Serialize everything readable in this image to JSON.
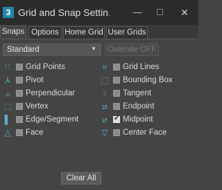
{
  "window": {
    "app_icon_text": "3",
    "title": "Grid and Snap Settin...",
    "minimize_glyph": "—",
    "close_glyph": "✕"
  },
  "tabs": [
    {
      "label": "Snaps",
      "active": true
    },
    {
      "label": "Options",
      "active": false
    },
    {
      "label": "Home Grid",
      "active": false
    },
    {
      "label": "User Grids",
      "active": false
    }
  ],
  "toolbar": {
    "dropdown_value": "Standard",
    "dropdown_arrow": "▼",
    "override_label": "Override OFF"
  },
  "snaps_left": [
    {
      "label": "Grid Points",
      "checked": false,
      "icon": "grid-points-icon",
      "glyph": "∷"
    },
    {
      "label": "Pivot",
      "checked": false,
      "icon": "pivot-icon",
      "glyph": "⅄"
    },
    {
      "label": "Perpendicular",
      "checked": false,
      "icon": "perpendicular-icon",
      "glyph": "⫨"
    },
    {
      "label": "Vertex",
      "checked": false,
      "icon": "vertex-icon",
      "glyph": "⬚"
    },
    {
      "label": "Edge/Segment",
      "checked": false,
      "icon": "edge-segment-icon",
      "glyph": "▌"
    },
    {
      "label": "Face",
      "checked": false,
      "icon": "face-icon",
      "glyph": "△"
    }
  ],
  "snaps_right": [
    {
      "label": "Grid Lines",
      "checked": false,
      "icon": "grid-lines-icon",
      "glyph": "⌗"
    },
    {
      "label": "Bounding Box",
      "checked": false,
      "icon": "bounding-box-icon",
      "glyph": "⬚"
    },
    {
      "label": "Tangent",
      "checked": false,
      "icon": "tangent-icon",
      "glyph": "⍤"
    },
    {
      "label": "Endpoint",
      "checked": false,
      "icon": "endpoint-icon",
      "glyph": "⧄"
    },
    {
      "label": "Midpoint",
      "checked": true,
      "icon": "midpoint-icon",
      "glyph": "⧄"
    },
    {
      "label": "Center Face",
      "checked": false,
      "icon": "center-face-icon",
      "glyph": "▽"
    }
  ],
  "actions": {
    "clear_all_label": "Clear All"
  },
  "colors": {
    "accent": "#5fb0d0",
    "background": "#444444",
    "titlebar": "#2b2b2b"
  }
}
